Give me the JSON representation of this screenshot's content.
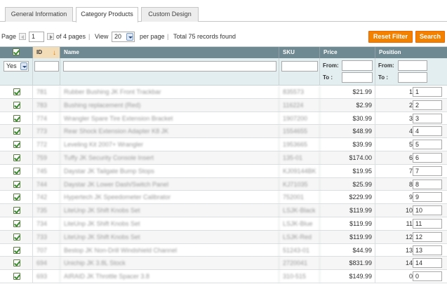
{
  "tabs": [
    {
      "label": "General Information"
    },
    {
      "label": "Category Products"
    },
    {
      "label": "Custom Design"
    }
  ],
  "pager": {
    "page_label": "Page",
    "page_value": "1",
    "of_pages": "of 4 pages",
    "view_label": "View",
    "view_value": "20",
    "per_page": "per page",
    "total": "Total 75 records found"
  },
  "buttons": {
    "reset": "Reset Filter",
    "search": "Search"
  },
  "columns": {
    "id": "ID",
    "name": "Name",
    "sku": "SKU",
    "price": "Price",
    "position": "Position"
  },
  "filters": {
    "in_category": "Yes",
    "from": "From:",
    "to": "To :"
  },
  "rows": [
    {
      "id": "781",
      "name": "Rubber Bushing JK Front Trackbar",
      "sku": "835573",
      "price": "$21.99",
      "position": "1",
      "position_input": "1"
    },
    {
      "id": "783",
      "name": "Bushing replacement (Red)",
      "sku": "116224",
      "price": "$2.99",
      "position": "2",
      "position_input": "2"
    },
    {
      "id": "774",
      "name": "Wrangler Spare Tire Extension Bracket",
      "sku": "1907200",
      "price": "$30.99",
      "position": "3",
      "position_input": "3"
    },
    {
      "id": "773",
      "name": "Rear Shock Extension Adapter K8 JK",
      "sku": "1554655",
      "price": "$48.99",
      "position": "4",
      "position_input": "4"
    },
    {
      "id": "772",
      "name": "Leveling Kit 2007+ Wrangler",
      "sku": "1953665",
      "price": "$39.99",
      "position": "5",
      "position_input": "5"
    },
    {
      "id": "759",
      "name": "Tuffy JK Security Console Insert",
      "sku": "135-01",
      "price": "$174.00",
      "position": "6",
      "position_input": "6"
    },
    {
      "id": "745",
      "name": "Daystar JK Tailgate Bump Stops",
      "sku": "KJ09144BK",
      "price": "$19.95",
      "position": "7",
      "position_input": "7"
    },
    {
      "id": "744",
      "name": "Daystar JK Lower Dash/Switch Panel",
      "sku": "KJ71035",
      "price": "$25.99",
      "position": "8",
      "position_input": "8"
    },
    {
      "id": "742",
      "name": "Hypertech JK Speedometer Calibrator",
      "sku": "752001",
      "price": "$229.99",
      "position": "9",
      "position_input": "9"
    },
    {
      "id": "735",
      "name": "LiteUnp JK Shift Knobs Set",
      "sku": "LSJK-Black",
      "price": "$119.99",
      "position": "10",
      "position_input": "10"
    },
    {
      "id": "734",
      "name": "LiteUnp JK Shift Knobs Set",
      "sku": "LSJK-Blue",
      "price": "$119.99",
      "position": "11",
      "position_input": "11"
    },
    {
      "id": "733",
      "name": "LiteUnp JK Shift Knobs Set",
      "sku": "LSJK-Red",
      "price": "$119.99",
      "position": "12",
      "position_input": "12"
    },
    {
      "id": "707",
      "name": "Bestop JK Non-Drill Windshield Channel",
      "sku": "51243-01",
      "price": "$44.99",
      "position": "13",
      "position_input": "13"
    },
    {
      "id": "694",
      "name": "Unichip JK 3.8L Stock",
      "sku": "2720041",
      "price": "$831.99",
      "position": "14",
      "position_input": "14"
    },
    {
      "id": "693",
      "name": "AIRAID JK Throttle Spacer 3.8",
      "sku": "310-515",
      "price": "$149.99",
      "position": "0",
      "position_input": "0"
    }
  ]
}
